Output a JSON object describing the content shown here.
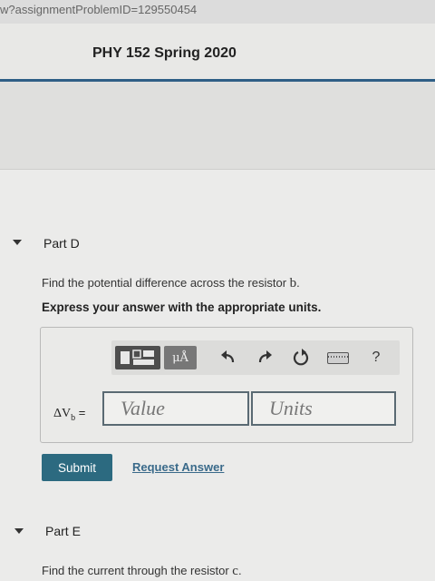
{
  "browser": {
    "url_fragment": "w?assignmentProblemID=129550454"
  },
  "header": {
    "course_title": "PHY 152 Spring 2020"
  },
  "part_d": {
    "label": "Part D",
    "question_prefix": "Find the potential difference across the resistor ",
    "question_var": "b",
    "question_suffix": ".",
    "instruction": "Express your answer with the appropriate units.",
    "variable_main": "ΔV",
    "variable_sub": "b",
    "variable_equals": " =",
    "value_placeholder": "Value",
    "units_placeholder": "Units",
    "toolbar": {
      "units_button_label": "μÅ",
      "icons": [
        "templates-icon",
        "units-icon",
        "undo-icon",
        "redo-icon",
        "reset-icon",
        "keyboard-icon",
        "help-icon"
      ],
      "help_label": "?"
    },
    "submit_label": "Submit",
    "request_answer_label": "Request Answer"
  },
  "part_e": {
    "label": "Part E",
    "question_prefix": "Find the current through the resistor ",
    "question_var": "c",
    "question_suffix": "."
  },
  "colors": {
    "header_rule": "#2f5f86",
    "submit_bg": "#2c6a80",
    "link": "#3a6a8a"
  }
}
